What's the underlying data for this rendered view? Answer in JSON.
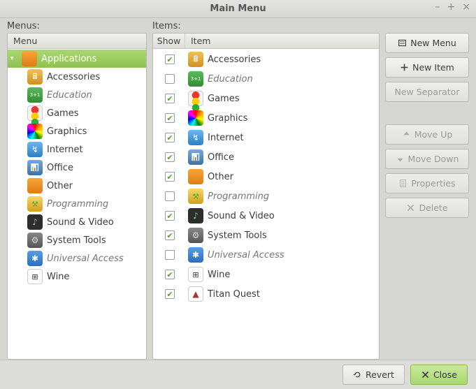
{
  "window": {
    "title": "Main Menu"
  },
  "labels": {
    "menus": "Menus:",
    "items": "Items:"
  },
  "columns": {
    "menu": "Menu",
    "show": "Show",
    "item": "Item"
  },
  "menus": {
    "root": {
      "label": "Applications",
      "icon": "applications-icon",
      "expanded": true,
      "selected": true
    },
    "children": [
      {
        "label": "Accessories",
        "icon": "accessories-icon",
        "enabled": true
      },
      {
        "label": "Education",
        "icon": "education-icon",
        "enabled": false
      },
      {
        "label": "Games",
        "icon": "games-icon",
        "enabled": true
      },
      {
        "label": "Graphics",
        "icon": "graphics-icon",
        "enabled": true
      },
      {
        "label": "Internet",
        "icon": "internet-icon",
        "enabled": true
      },
      {
        "label": "Office",
        "icon": "office-icon",
        "enabled": true
      },
      {
        "label": "Other",
        "icon": "other-icon",
        "enabled": true
      },
      {
        "label": "Programming",
        "icon": "programming-icon",
        "enabled": false
      },
      {
        "label": "Sound & Video",
        "icon": "sound-video-icon",
        "enabled": true
      },
      {
        "label": "System Tools",
        "icon": "system-tools-icon",
        "enabled": true
      },
      {
        "label": "Universal Access",
        "icon": "universal-access-icon",
        "enabled": false
      },
      {
        "label": "Wine",
        "icon": "wine-icon",
        "enabled": true
      }
    ]
  },
  "items": [
    {
      "label": "Accessories",
      "icon": "accessories-icon",
      "show": true
    },
    {
      "label": "Education",
      "icon": "education-icon",
      "show": false
    },
    {
      "label": "Games",
      "icon": "games-icon",
      "show": true
    },
    {
      "label": "Graphics",
      "icon": "graphics-icon",
      "show": true
    },
    {
      "label": "Internet",
      "icon": "internet-icon",
      "show": true
    },
    {
      "label": "Office",
      "icon": "office-icon",
      "show": true
    },
    {
      "label": "Other",
      "icon": "other-icon",
      "show": true
    },
    {
      "label": "Programming",
      "icon": "programming-icon",
      "show": false
    },
    {
      "label": "Sound & Video",
      "icon": "sound-video-icon",
      "show": true
    },
    {
      "label": "System Tools",
      "icon": "system-tools-icon",
      "show": true
    },
    {
      "label": "Universal Access",
      "icon": "universal-access-icon",
      "show": false
    },
    {
      "label": "Wine",
      "icon": "wine-icon",
      "show": true
    },
    {
      "label": "Titan Quest",
      "icon": "titan-quest-icon",
      "show": true
    }
  ],
  "buttons": {
    "new_menu": "New Menu",
    "new_item": "New Item",
    "new_separator": "New Separator",
    "move_up": "Move Up",
    "move_down": "Move Down",
    "properties": "Properties",
    "delete": "Delete",
    "revert": "Revert",
    "close": "Close"
  },
  "button_states": {
    "new_separator": false,
    "move_up": false,
    "move_down": false,
    "properties": false,
    "delete": false
  },
  "icon_map": {
    "applications-icon": "ic-apps",
    "accessories-icon": "ic-acc",
    "education-icon": "ic-edu",
    "games-icon": "ic-games",
    "graphics-icon": "ic-gfx",
    "internet-icon": "ic-net",
    "office-icon": "ic-office",
    "other-icon": "ic-other",
    "programming-icon": "ic-prog",
    "sound-video-icon": "ic-sv",
    "system-tools-icon": "ic-sys",
    "universal-access-icon": "ic-ua",
    "wine-icon": "ic-wine",
    "titan-quest-icon": "ic-titan"
  }
}
